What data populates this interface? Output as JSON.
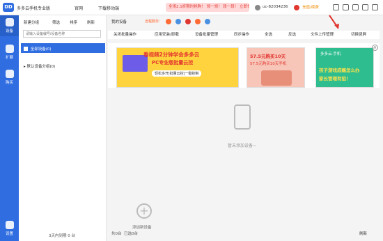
{
  "app": {
    "logo": "DD",
    "title": "多多云手机专业版"
  },
  "header": {
    "website": "官网",
    "download": "下载移动端",
    "promo": "全场2.1折限时抢购！ 领一领！ 段一段！ 立即领取",
    "username": "uc-82034236",
    "recharge": "充值/续费"
  },
  "sidebar": {
    "items": [
      {
        "label": "设备",
        "icon": "phone-cloud-icon"
      },
      {
        "label": "扩展",
        "icon": "grid-icon"
      },
      {
        "label": "购买",
        "icon": "cart-icon"
      },
      {
        "label": "设置",
        "icon": "gear-icon"
      }
    ]
  },
  "groups": {
    "toolbar": {
      "new": "新建分组",
      "filter": "筛选",
      "sort": "排序",
      "refresh": "刷新"
    },
    "search_placeholder": "请输入设备编号/设备名称",
    "all_group": "全部设备(0)",
    "default_group": "默认设备分组(0)",
    "footer": "3天内到期 0 台"
  },
  "main": {
    "my_devices": "我的设备",
    "control_service": "远程服务："
  },
  "toolbar": {
    "close_batch": "关闭批量操作",
    "app_install": "应用安装/卸载",
    "batch_manage": "设备批量管理",
    "sync": "同步操作",
    "select_all": "全选",
    "invert": "反选",
    "file_upload": "文件上传管理",
    "switch_screen": "切换竖屏"
  },
  "banners": {
    "b1_line1": "看视频2分钟学会多多云",
    "b1_line2": "PC专业版批量云控",
    "b1_line3": "轻松多开|批量云控|一键控制",
    "b2_line1": "57.5元购买10天",
    "b2_line2": "57.5元购买10天手机",
    "b3_line1": "多多云·手机",
    "b3_line2": "孩子游戏成瘾怎么办",
    "b3_line3": "家长管理有招！"
  },
  "empty": {
    "text": "暂未添加设备~"
  },
  "add_device": {
    "plus": "+",
    "label": "添加新设备"
  },
  "status": {
    "total": "共0台",
    "selected": "已选0台",
    "refresh": "刷新"
  },
  "colors": {
    "primary": "#2f6de1",
    "accent": "#e0362f",
    "banner_yellow": "#ffd33d",
    "banner_green": "#2ebd8f"
  }
}
